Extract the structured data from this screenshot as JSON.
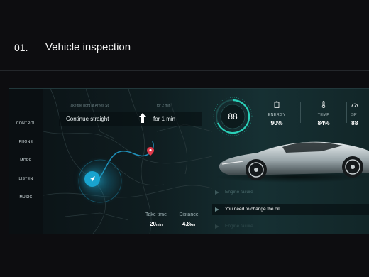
{
  "header": {
    "index": "01.",
    "title": "Vehicle inspection"
  },
  "sidebar": {
    "items": [
      {
        "label": "CONTROL"
      },
      {
        "label": "PHONE"
      },
      {
        "label": "MORE"
      },
      {
        "label": "LISTEN"
      },
      {
        "label": "MUSIC"
      }
    ]
  },
  "navigation": {
    "hint_left": "Take the right at Arnes St.",
    "hint_right": "for 2 min",
    "instruction": "Continue straight",
    "instruction_time": "for 1 min",
    "take_time_label": "Take time",
    "take_time_value": "20",
    "take_time_unit": "min",
    "distance_label": "Distance",
    "distance_value": "4.8",
    "distance_unit": "km"
  },
  "speed": {
    "value": "88"
  },
  "metrics": [
    {
      "label": "ENERGY",
      "value": "90%",
      "icon": "battery-icon"
    },
    {
      "label": "TEMP",
      "value": "84%",
      "icon": "thermometer-icon"
    },
    {
      "label": "SP",
      "value": "88",
      "icon": "speed-icon"
    }
  ],
  "alerts": [
    {
      "text": "Engine failure",
      "active": false
    },
    {
      "text": "You need to change the oil",
      "active": true
    },
    {
      "text": "Engine failure",
      "active": false
    }
  ],
  "colors": {
    "accent": "#19a4cf",
    "teal": "#2ad0b8",
    "pin": "#e0394a",
    "background": "#0d0d10"
  }
}
